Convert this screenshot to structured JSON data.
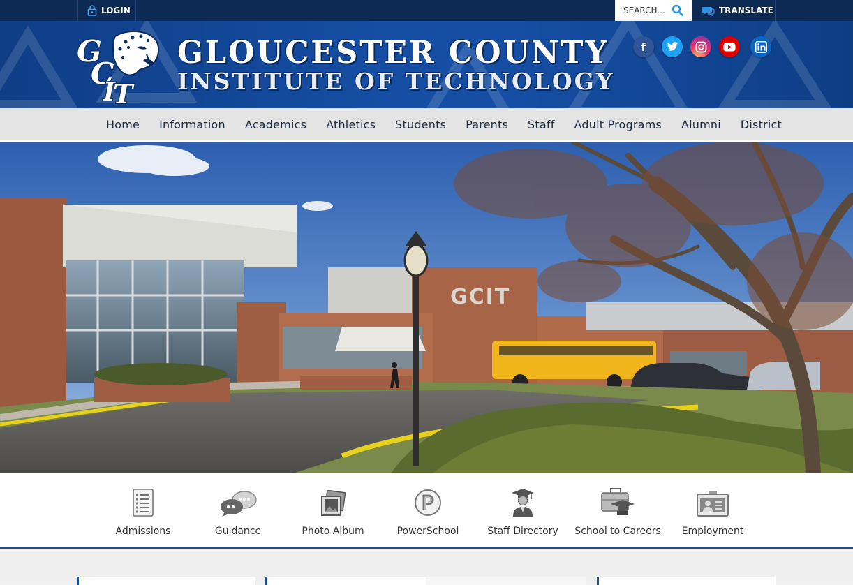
{
  "topbar": {
    "login_label": "LOGIN",
    "search_placeholder": "SEARCH...",
    "translate_label": "TRANSLATE"
  },
  "header": {
    "logo_text": "GCIT",
    "title_line1": "GLOUCESTER COUNTY",
    "title_line2": "INSTITUTE OF TECHNOLOGY"
  },
  "social": [
    {
      "name": "facebook",
      "glyph": "f",
      "color": "#2f5597"
    },
    {
      "name": "twitter",
      "glyph": "t",
      "color": "#1da1f2"
    },
    {
      "name": "instagram",
      "glyph": "◎",
      "color": "#c13584"
    },
    {
      "name": "youtube",
      "glyph": "▶",
      "color": "#e00000"
    },
    {
      "name": "linkedin",
      "glyph": "in",
      "color": "#0a66c2"
    }
  ],
  "nav": [
    "Home",
    "Information",
    "Academics",
    "Athletics",
    "Students",
    "Parents",
    "Staff",
    "Adult Programs",
    "Alumni",
    "District"
  ],
  "hero": {
    "sign_text": "GCIT"
  },
  "quick_links": [
    {
      "label": "Admissions",
      "icon": "checklist-icon"
    },
    {
      "label": "Guidance",
      "icon": "chat-bubbles-icon"
    },
    {
      "label": "Photo Album",
      "icon": "photo-album-icon"
    },
    {
      "label": "PowerSchool",
      "icon": "powerschool-icon"
    },
    {
      "label": "Staff Directory",
      "icon": "graduate-icon"
    },
    {
      "label": "School to Careers",
      "icon": "briefcase-cap-icon"
    },
    {
      "label": "Employment",
      "icon": "id-card-icon"
    }
  ],
  "colors": {
    "topbar": "#0d2a55",
    "header": "#154ea3",
    "nav_bg": "#e4e4e4",
    "accent": "#1b4d8f"
  }
}
